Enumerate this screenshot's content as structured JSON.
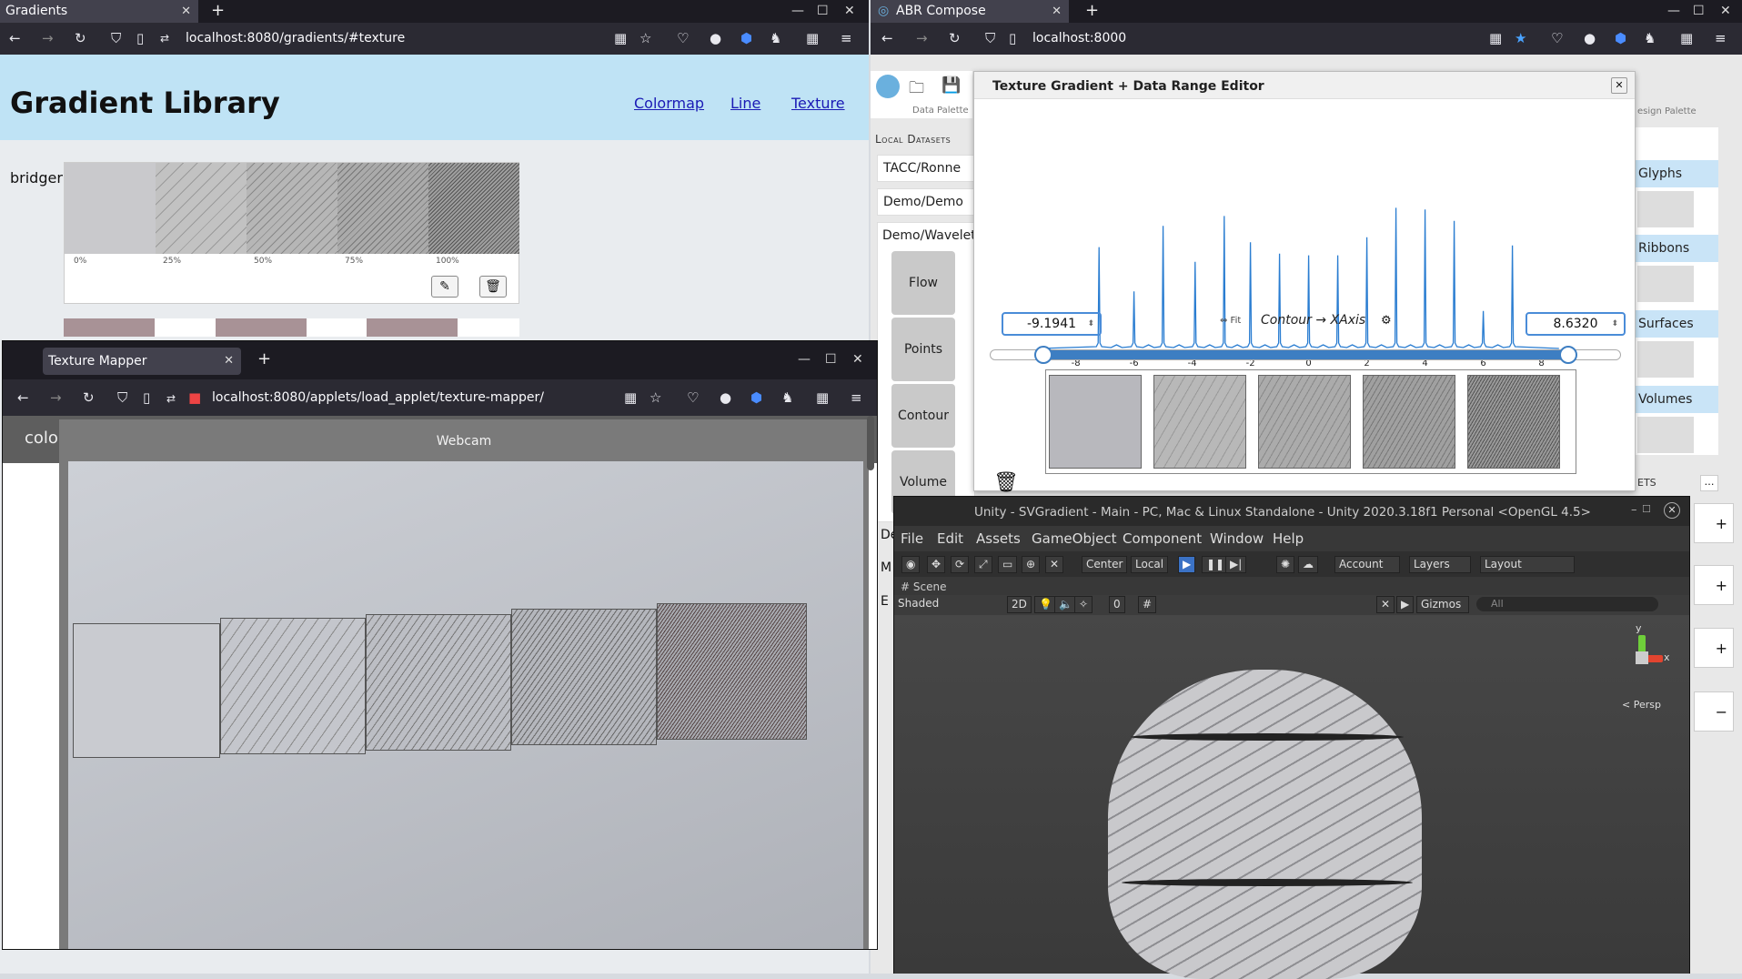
{
  "left_browser": {
    "tab_title": "Gradients",
    "url": "localhost:8080/gradients/#texture",
    "page_title": "Gradient Library",
    "nav_links": [
      "Colormap",
      "Line",
      "Texture"
    ],
    "gradient_name": "bridger",
    "ticks": [
      "0%",
      "25%",
      "50%",
      "75%",
      "100%"
    ]
  },
  "mapper": {
    "tab_title": "Texture Mapper",
    "url": "localhost:8080/applets/load_applet/texture-mapper/",
    "side_label": "colo",
    "webcam_label": "Webcam"
  },
  "abr": {
    "tab_title": "ABR Compose",
    "url": "localhost:8000",
    "data_palette_label": "Data Palette",
    "design_palette_label": "esign Palette",
    "local_datasets_label": "Local Datasets",
    "datasets": [
      "TACC/Ronne",
      "Demo/Demo",
      "Demo/Wavelet"
    ],
    "buttons": [
      "Flow",
      "Points",
      "Contour",
      "Volume"
    ],
    "partial_items": [
      "De",
      "M",
      "E"
    ],
    "right_panel": [
      "Glyphs",
      "Ribbons",
      "Surfaces",
      "Volumes"
    ],
    "ets_label": "ETS",
    "editor": {
      "title": "Texture Gradient + Data Range Editor",
      "min_value": "-9.1941",
      "max_value": "8.6320",
      "fit_label": "⇔ Fit",
      "mapping_label": "Contour → XAxis",
      "axis_ticks": [
        "-8",
        "-6",
        "-4",
        "-2",
        "0",
        "2",
        "4",
        "6",
        "8"
      ]
    }
  },
  "unity": {
    "title": "Unity - SVGradient - Main - PC, Mac & Linux Standalone - Unity 2020.3.18f1 Personal <OpenGL 4.5>",
    "menu": [
      "File",
      "Edit",
      "Assets",
      "GameObject",
      "Component",
      "Window",
      "Help"
    ],
    "center_label": "Center",
    "local_label": "Local",
    "account_label": "Account",
    "layers_label": "Layers",
    "layout_label": "Layout",
    "scene_tab": "Scene",
    "shading_mode": "Shaded",
    "mode_2d": "2D",
    "gizmos_label": "Gizmos",
    "search_placeholder": "All",
    "persp_label": "< Persp",
    "fx_count": "0",
    "axis_y": "y",
    "axis_x": "x"
  }
}
